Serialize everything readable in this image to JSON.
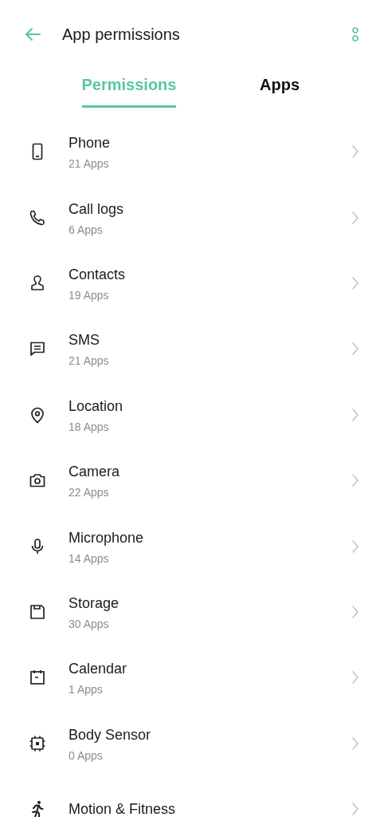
{
  "header": {
    "title": "App permissions"
  },
  "tabs": [
    {
      "label": "Permissions",
      "selected": true
    },
    {
      "label": "Apps",
      "selected": false
    }
  ],
  "permissions": [
    {
      "name": "Phone",
      "count": "21 Apps"
    },
    {
      "name": "Call logs",
      "count": "6 Apps"
    },
    {
      "name": "Contacts",
      "count": "19 Apps"
    },
    {
      "name": "SMS",
      "count": "21 Apps"
    },
    {
      "name": "Location",
      "count": "18 Apps"
    },
    {
      "name": "Camera",
      "count": "22 Apps"
    },
    {
      "name": "Microphone",
      "count": "14 Apps"
    },
    {
      "name": "Storage",
      "count": "30 Apps"
    },
    {
      "name": "Calendar",
      "count": "1 Apps"
    },
    {
      "name": "Body Sensor",
      "count": "0 Apps"
    },
    {
      "name": "Motion & Fitness"
    }
  ]
}
